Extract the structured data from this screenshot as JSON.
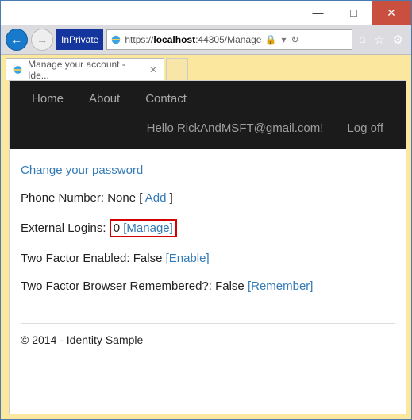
{
  "titlebar": {
    "minimize": "—",
    "maximize": "□",
    "close": "✕"
  },
  "address": {
    "inprivate": "InPrivate",
    "scheme": "https://",
    "host": "localhost",
    "port_path": ":44305/Manage"
  },
  "tab": {
    "title": "Manage your account - Ide..."
  },
  "nav": {
    "home": "Home",
    "about": "About",
    "contact": "Contact",
    "greeting": "Hello RickAndMSFT@gmail.com!",
    "logoff": "Log off"
  },
  "page": {
    "change_pw": "Change your password",
    "phone_label": "Phone Number: None [ ",
    "phone_add": "Add",
    "phone_close": " ]",
    "ext_label": "External Logins:",
    "ext_count": "0",
    "ext_manage": "[Manage]",
    "tf_label": "Two Factor Enabled: False ",
    "tf_enable": "[Enable]",
    "tfb_label": "Two Factor Browser Remembered?: False ",
    "tfb_remember": "[Remember]",
    "footer": "© 2014 - Identity Sample"
  }
}
